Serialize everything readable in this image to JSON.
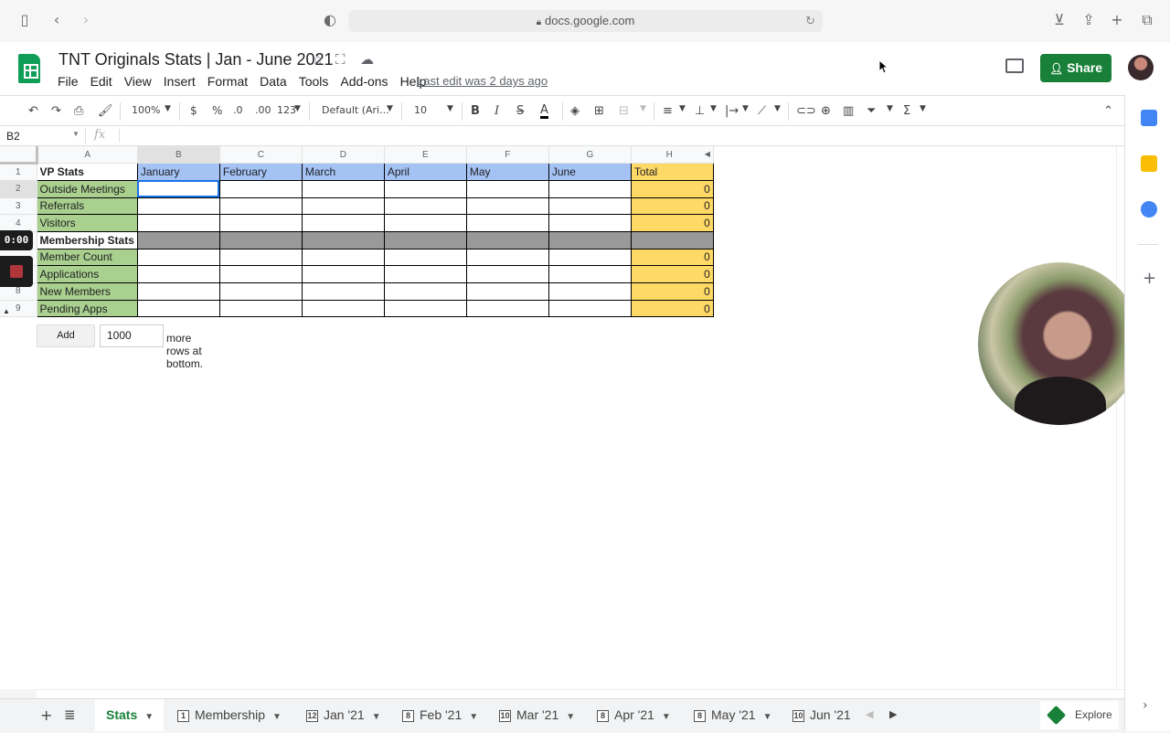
{
  "browser": {
    "url": "docs.google.com"
  },
  "doc": {
    "title": "TNT Originals Stats | Jan - June 2021",
    "menu": [
      "File",
      "Edit",
      "View",
      "Insert",
      "Format",
      "Data",
      "Tools",
      "Add-ons",
      "Help"
    ],
    "last_edit": "Last edit was 2 days ago",
    "share_label": "Share"
  },
  "toolbar": {
    "zoom": "100%",
    "currency": "$",
    "percent": "%",
    "dec_decrease": ".0",
    "dec_increase": ".00",
    "more_formats": "123",
    "font": "Default (Ari...",
    "font_size": "10",
    "bold": "B",
    "italic": "I",
    "strike": "S",
    "text_color": "A"
  },
  "formula": {
    "name_box": "B2",
    "fx": "fx",
    "value": ""
  },
  "sheet": {
    "column_headers": [
      "A",
      "B",
      "C",
      "D",
      "E",
      "F",
      "G",
      "H"
    ],
    "rows": [
      {
        "n": "1",
        "cells": [
          "VP Stats",
          "January",
          "February",
          "March",
          "April",
          "May",
          "June",
          "Total"
        ]
      },
      {
        "n": "2",
        "cells": [
          "Outside Meetings",
          "",
          "",
          "",
          "",
          "",
          "",
          "0"
        ]
      },
      {
        "n": "3",
        "cells": [
          "Referrals",
          "",
          "",
          "",
          "",
          "",
          "",
          "0"
        ]
      },
      {
        "n": "4",
        "cells": [
          "Visitors",
          "",
          "",
          "",
          "",
          "",
          "",
          "0"
        ]
      },
      {
        "n": "",
        "cells": [
          "Membership Stats",
          "",
          "",
          "",
          "",
          "",
          "",
          ""
        ]
      },
      {
        "n": "",
        "cells": [
          "Member Count",
          "",
          "",
          "",
          "",
          "",
          "",
          "0"
        ]
      },
      {
        "n": "",
        "cells": [
          "Applications",
          "",
          "",
          "",
          "",
          "",
          "",
          "0"
        ]
      },
      {
        "n": "8",
        "cells": [
          "New Members",
          "",
          "",
          "",
          "",
          "",
          "",
          "0"
        ]
      },
      {
        "n": "9",
        "cells": [
          "Pending Apps",
          "",
          "",
          "",
          "",
          "",
          "",
          "0"
        ]
      }
    ],
    "add_label": "Add",
    "add_rows_value": "1000",
    "add_rows_suffix": "more rows at bottom."
  },
  "recording": {
    "timer": "0:00"
  },
  "tabs": [
    {
      "num": "",
      "label": "Stats",
      "active": true
    },
    {
      "num": "1",
      "label": "Membership"
    },
    {
      "num": "12",
      "label": "Jan '21"
    },
    {
      "num": "8",
      "label": "Feb '21"
    },
    {
      "num": "10",
      "label": "Mar '21"
    },
    {
      "num": "8",
      "label": "Apr '21"
    },
    {
      "num": "8",
      "label": "May '21"
    },
    {
      "num": "10",
      "label": "Jun '21"
    }
  ],
  "explore_label": "Explore",
  "colors": {
    "share": "#188038",
    "header_blue": "#a4c2f4",
    "label_green": "#a9d08e",
    "total_gold": "#ffd966",
    "divider_gray": "#999999"
  }
}
